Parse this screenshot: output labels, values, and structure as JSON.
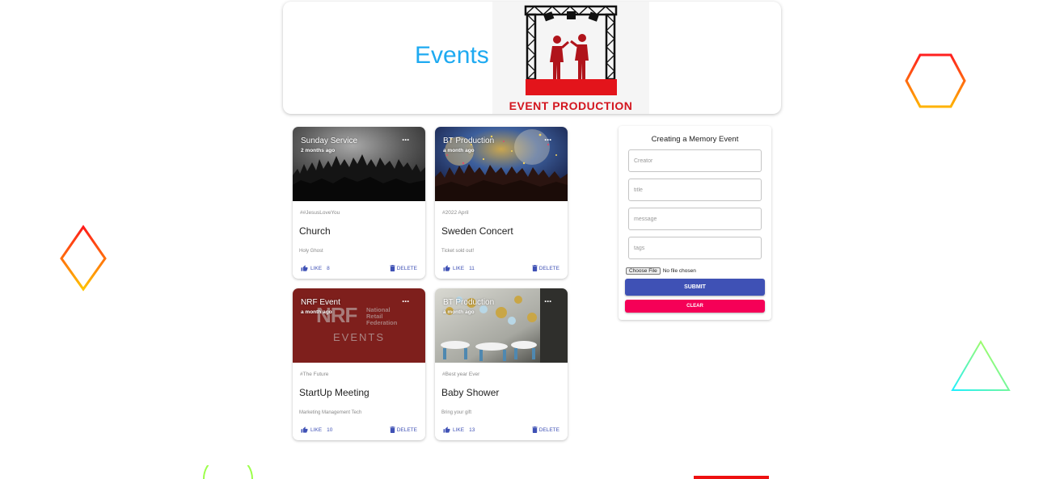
{
  "header": {
    "title": "Events",
    "logo_text": "EVENT PRODUCTION"
  },
  "posts": [
    {
      "creator": "Sunday Service",
      "time": "2 months ago",
      "tags": "##JesusLoveYou",
      "title": "Church",
      "message": "Holy Ghost",
      "like_label": "LIKE",
      "like_count": "8",
      "delete_label": "DELETE",
      "image": "concert-crowd"
    },
    {
      "creator": "BT Production",
      "time": "a month ago",
      "tags": "#2022 April",
      "title": "Sweden Concert",
      "message": "Ticket sold out!",
      "like_label": "LIKE",
      "like_count": "11",
      "delete_label": "DELETE",
      "image": "confetti-concert"
    },
    {
      "creator": "NRF Event",
      "time": "a month ago",
      "tags": "#The Future",
      "title": "StartUp Meeting",
      "message": "Marketing Management Tech",
      "like_label": "LIKE",
      "like_count": "10",
      "delete_label": "DELETE",
      "image": "nrf-logo",
      "image_text": {
        "nrf": "NRF",
        "line1": "National",
        "line2": "Retail",
        "line3": "Federation",
        "events": "EVENTS"
      }
    },
    {
      "creator": "BT Production",
      "time": "a month ago",
      "tags": "#Best year Ever",
      "title": "Baby Shower",
      "message": "Bring your gift",
      "like_label": "LIKE",
      "like_count": "13",
      "delete_label": "DELETE",
      "image": "balloon-hall"
    }
  ],
  "form": {
    "title": "Creating a Memory Event",
    "creator_placeholder": "Creator",
    "title_placeholder": "title",
    "message_placeholder": "message",
    "tags_placeholder": "tags",
    "file_button": "Choose File",
    "file_status": "No file chosen",
    "submit_label": "SUBMIT",
    "clear_label": "CLEAR"
  },
  "colors": {
    "title_blue": "#1eaaf1",
    "primary": "#3f51b5",
    "secondary": "#f50057",
    "logo_red": "#d3151e"
  }
}
